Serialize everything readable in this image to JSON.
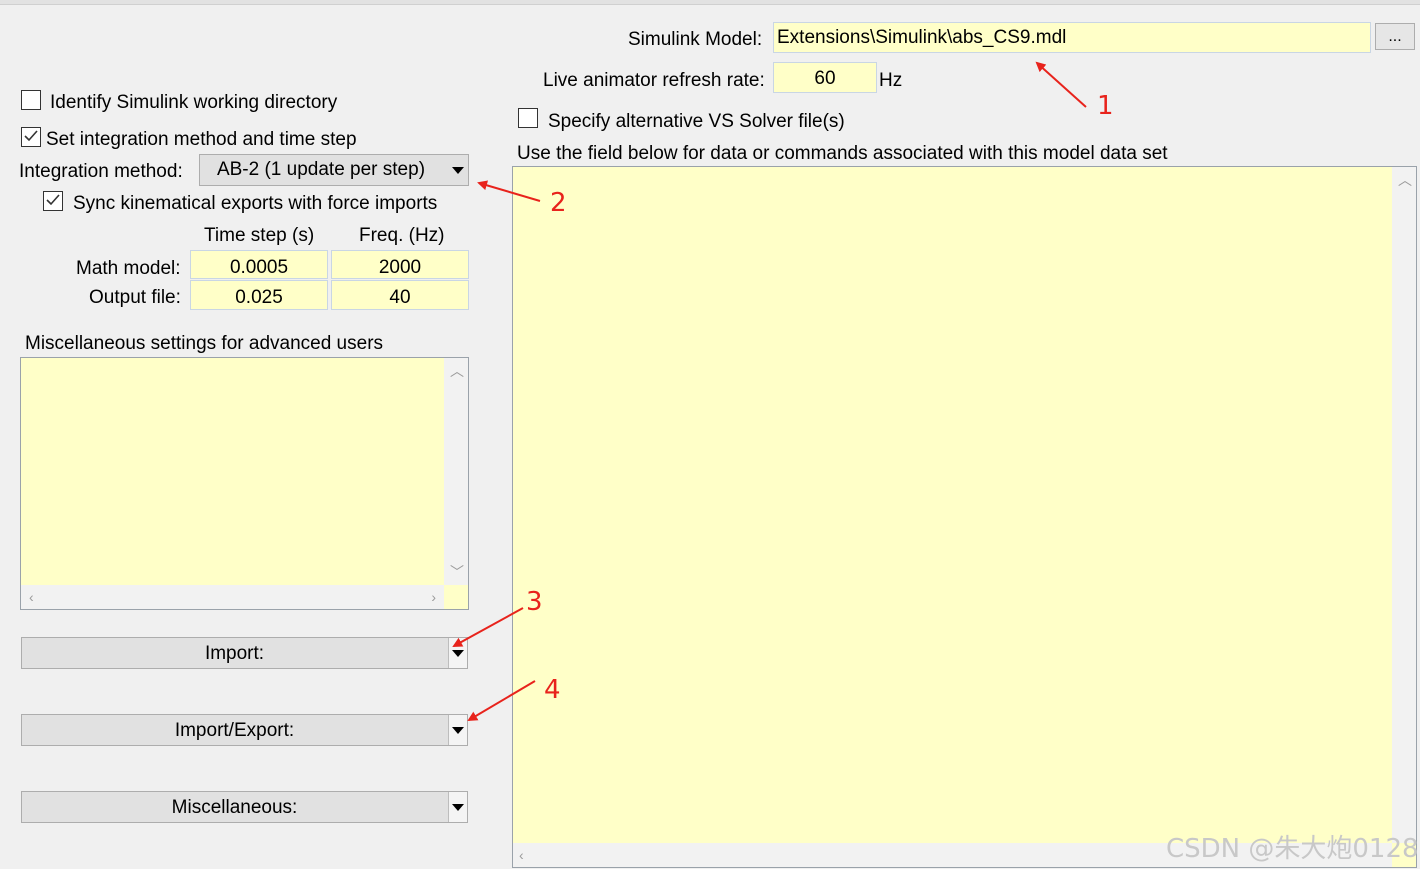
{
  "model": {
    "label": "Simulink Model:",
    "path": "Extensions\\Simulink\\abs_CS9.mdl",
    "browse_label": "..."
  },
  "animator": {
    "label": "Live animator refresh rate:",
    "value": "60",
    "unit": "Hz"
  },
  "solver": {
    "label": "Specify alternative VS Solver file(s)",
    "checked": false
  },
  "data_field": {
    "label": "Use the field below  for data or commands associated with this model data set"
  },
  "settings": {
    "identify_dir": {
      "label": "Identify Simulink working directory",
      "checked": false
    },
    "set_integration": {
      "label": "Set integration method and time step",
      "checked": true
    },
    "integration_method": {
      "label": "Integration method:",
      "value": "AB-2 (1 update per step)"
    },
    "sync_exports": {
      "label": "Sync kinematical exports with force imports",
      "checked": true
    }
  },
  "timing": {
    "headers": [
      "Time step (s)",
      "Freq. (Hz)"
    ],
    "rows": [
      {
        "label": "Math model:",
        "time_step": "0.0005",
        "freq": "2000"
      },
      {
        "label": "Output file:",
        "time_step": "0.025",
        "freq": "40"
      }
    ]
  },
  "misc_settings": {
    "label": "Miscellaneous settings for advanced users"
  },
  "popups": {
    "import": "Import:",
    "import_export": "Import/Export:",
    "miscellaneous": "Miscellaneous:"
  },
  "annotations": [
    "1",
    "2",
    "3",
    "4"
  ],
  "annotation_color": "#e8231c",
  "field_color": "#ffffc8",
  "watermark": "CSDN @朱大炮0128"
}
